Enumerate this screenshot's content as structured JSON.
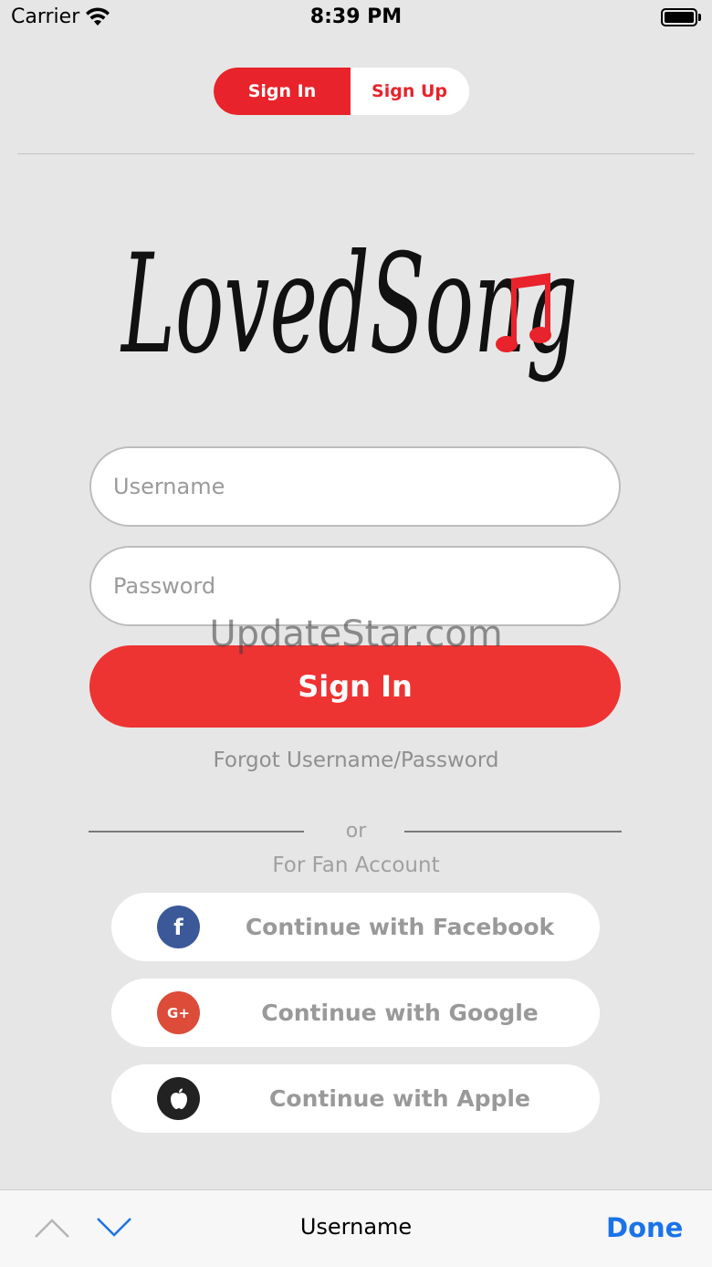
{
  "status_bar": {
    "carrier": "Carrier",
    "time": "8:39 PM"
  },
  "auth_tabs": {
    "active": "Sign In",
    "inactive": "Sign Up"
  },
  "logo": {
    "text": "LovedSong"
  },
  "form": {
    "username_placeholder": "Username",
    "username_value": "",
    "password_placeholder": "Password",
    "password_value": "",
    "submit_label": "Sign In",
    "forgot_label": "Forgot Username/Password"
  },
  "watermark": "UpdateStar.com",
  "divider": {
    "or": "or",
    "fan_account": "For Fan Account"
  },
  "social": [
    {
      "label": "Continue with Facebook",
      "icon": "facebook-icon",
      "color": "#3b5998"
    },
    {
      "label": "Continue with Google",
      "icon": "google-plus-icon",
      "color": "#dd4b39"
    },
    {
      "label": "Continue with Apple",
      "icon": "apple-icon",
      "color": "#222222"
    }
  ],
  "keyboard_toolbar": {
    "field_title": "Username",
    "done_label": "Done"
  },
  "colors": {
    "brand_red": "#e8232b",
    "done_blue": "#1a73e8"
  }
}
